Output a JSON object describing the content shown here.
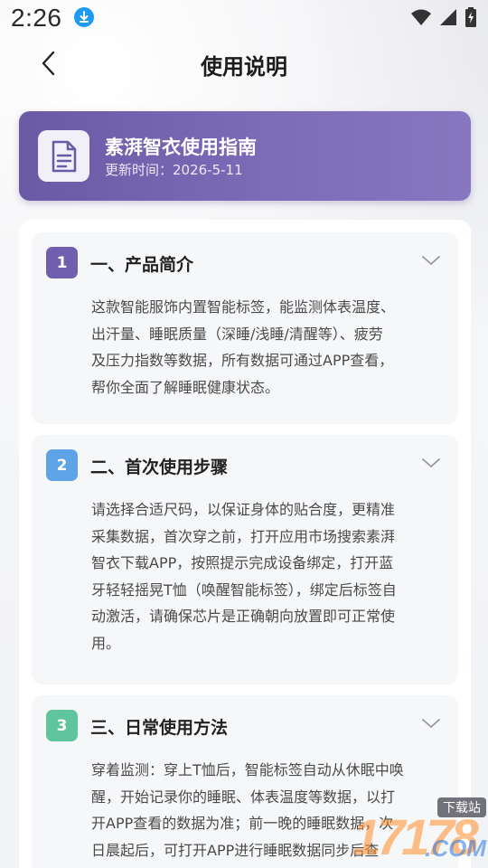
{
  "status_bar": {
    "time": "2:26",
    "icons": [
      "download-icon",
      "wifi-icon",
      "signal-icon",
      "battery-charging-icon"
    ]
  },
  "nav": {
    "title": "使用说明",
    "back_icon": "back-arrow-icon"
  },
  "guide": {
    "title": "素湃智衣使用指南",
    "updated": "更新时间：2026-5-11",
    "icon": "document-icon"
  },
  "sections": [
    {
      "number": "1",
      "title": "一、产品简介",
      "color": "#6f5fae",
      "lines": [
        "这款智能服饰内置智能标签，能监测体表温度、",
        "出汗量、睡眠质量（深睡/浅睡/清醒等）、疲劳",
        "及压力指数等数据，所有数据可通过APP查看，",
        "帮你全面了解睡眠健康状态。"
      ]
    },
    {
      "number": "2",
      "title": "二、首次使用步骤",
      "color": "#5ea3e6",
      "lines": [
        "请选择合适尺码，以保证身体的贴合度，更精准",
        "采集数据，首次穿之前，打开应用市场搜索素湃",
        "智衣下载APP，按照提示完成设备绑定，打开蓝",
        "牙轻轻摇晃T恤（唤醒智能标签），绑定后标签自",
        "动激活，请确保芯片是正确朝向放置即可正常使",
        "用。"
      ]
    },
    {
      "number": "3",
      "title": "三、日常使用方法",
      "color": "#5fc59f",
      "lines": [
        "穿着监测：穿上T恤后，智能标签自动从休眠中唤",
        "醒，开始记录你的睡眠、体表温度等数据，以打",
        "开APP查看的数据为准；前一晚的睡眠数据，次",
        "日晨起后，可打开APP进行睡眠数据同步后查"
      ]
    }
  ],
  "watermark": {
    "digits": "17178",
    "suffix": ".COM",
    "badge": "下载站"
  }
}
